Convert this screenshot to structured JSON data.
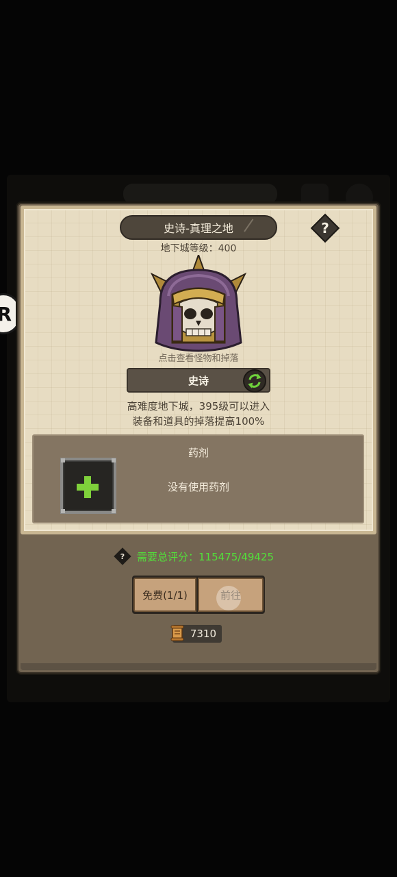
{
  "side_button": {
    "label": "R"
  },
  "dungeon": {
    "title": "史诗-真理之地",
    "help_label": "?",
    "level_text": "地下城等级：400",
    "boss_icon": "skull-helmet-icon",
    "hint_text": "点击查看怪物和掉落",
    "mode_label": "史诗",
    "mode_switch_icon": "swap-arrows-icon",
    "description_line1": "高难度地下城，395级可以进入",
    "description_line2": "装备和道具的掉落提高100%"
  },
  "potion": {
    "title": "药剂",
    "slot_icon": "plus-icon",
    "empty_text": "没有使用药剂"
  },
  "requirement": {
    "help_label": "?",
    "text": "需要总评分：115475/49425",
    "color": "#52e03a"
  },
  "actions": {
    "free_label": "免费(1/1)",
    "go_label": "前往"
  },
  "currency": {
    "icon": "scroll-icon",
    "amount": "7310"
  }
}
